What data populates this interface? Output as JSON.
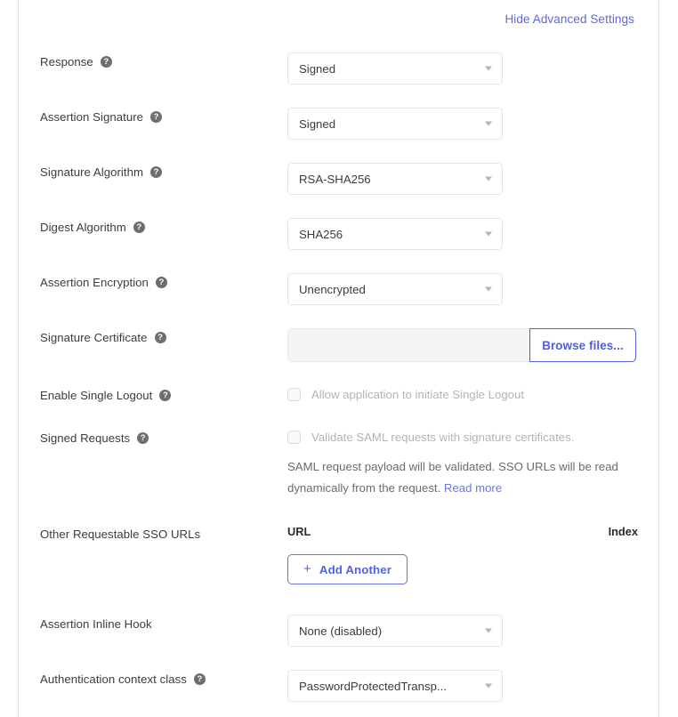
{
  "panel": {
    "advanced_toggle_label": "Hide Advanced Settings"
  },
  "icons": {
    "help": "?",
    "plus": "+"
  },
  "rows": {
    "response": {
      "label": "Response",
      "value": "Signed"
    },
    "assertion_signature": {
      "label": "Assertion Signature",
      "value": "Signed"
    },
    "signature_algorithm": {
      "label": "Signature Algorithm",
      "value": "RSA-SHA256"
    },
    "digest_algorithm": {
      "label": "Digest Algorithm",
      "value": "SHA256"
    },
    "assertion_encryption": {
      "label": "Assertion Encryption",
      "value": "Unencrypted"
    },
    "signature_certificate": {
      "label": "Signature Certificate",
      "value": "",
      "browse_label": "Browse files..."
    },
    "enable_single_logout": {
      "label": "Enable Single Logout",
      "checkbox_label": "Allow application to initiate Single Logout",
      "checked": false
    },
    "signed_requests": {
      "label": "Signed Requests",
      "checkbox_label": "Validate SAML requests with signature certificates.",
      "checked": false,
      "helper_text": "SAML request payload will be validated. SSO URLs will be read dynamically from the request. ",
      "helper_link": "Read more"
    },
    "other_sso_urls": {
      "label": "Other Requestable SSO URLs",
      "col_url": "URL",
      "col_index": "Index",
      "add_label": "Add Another"
    },
    "assertion_inline_hook": {
      "label": "Assertion Inline Hook",
      "value": "None (disabled)"
    },
    "auth_context_class": {
      "label": "Authentication context class",
      "value": "PasswordProtectedTransp..."
    }
  },
  "colors": {
    "link_blue": "#5b68df",
    "accent_blue": "#4f5fd7",
    "muted_text": "#6b6b6b",
    "disabled_text": "#b4b4b4"
  }
}
